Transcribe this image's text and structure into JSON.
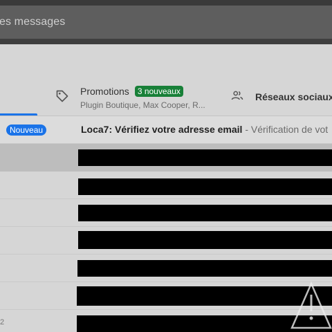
{
  "search": {
    "placeholder_fragment": "es messages"
  },
  "tabs": {
    "promotions": {
      "label": "Promotions",
      "badge": "3 nouveaux",
      "senders": "Plugin Boutique, Max Cooper, R..."
    },
    "social": {
      "label": "Réseaux sociaux"
    }
  },
  "unread_email": {
    "badge": "Nouveau",
    "subject": "Loca7: Vérifiez votre adresse email",
    "snippet": " - Vérification de vot"
  },
  "rows": [
    {
      "date_fragment": ""
    },
    {
      "date_fragment": ""
    },
    {
      "date_fragment": ""
    },
    {
      "date_fragment": ""
    },
    {
      "date_fragment": ""
    },
    {
      "date_fragment": ""
    },
    {
      "date_fragment": "2"
    }
  ],
  "colors": {
    "badge_green": "#188038",
    "badge_blue": "#1a73e8",
    "redaction": "#000000"
  }
}
